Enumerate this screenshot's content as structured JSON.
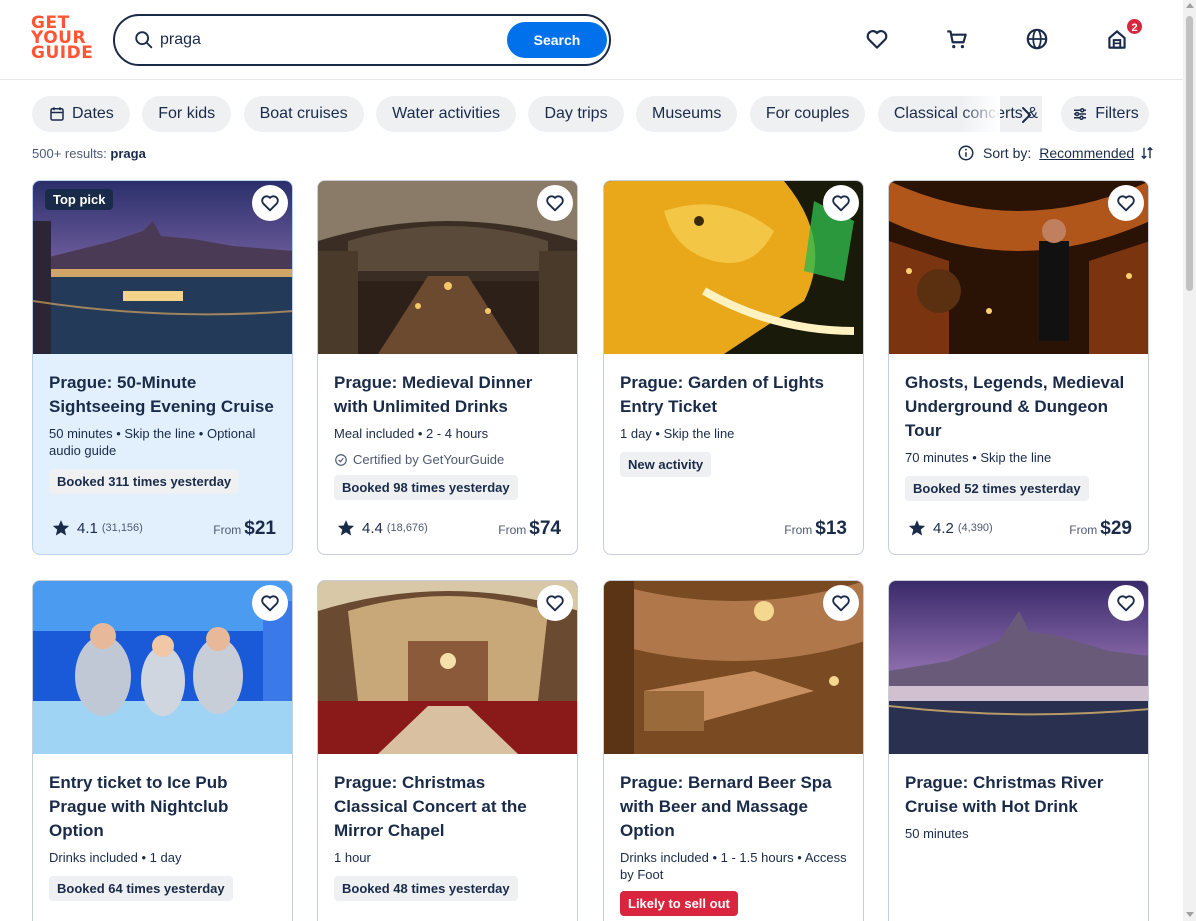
{
  "logo": {
    "line1": "GET",
    "line2": "YOUR",
    "line3": "GUIDE"
  },
  "search": {
    "value": "praga",
    "button_label": "Search"
  },
  "header": {
    "cart_badge": "2"
  },
  "chips": [
    "Dates",
    "For kids",
    "Boat cruises",
    "Water activities",
    "Day trips",
    "Museums",
    "For couples",
    "Classical concerts & opera"
  ],
  "filters_label": "Filters",
  "results": {
    "count": "500+ results:",
    "query": "praga"
  },
  "sort": {
    "label": "Sort by:",
    "value": "Recommended"
  },
  "cards": [
    {
      "title": "Prague: 50-Minute Sightseeing Evening Cruise",
      "meta": "50 minutes • Skip the line • Optional audio guide",
      "pill": "Booked 311 times yesterday",
      "rating": "4.1",
      "reviews": "(31,156)",
      "from": "From",
      "price": "$21",
      "tag": "Top pick"
    },
    {
      "title": "Prague: Medieval Dinner with Unlimited Drinks",
      "meta": "Meal included • 2 - 4 hours",
      "certified": "Certified by GetYourGuide",
      "pill": "Booked 98 times yesterday",
      "rating": "4.4",
      "reviews": "(18,676)",
      "from": "From",
      "price": "$74"
    },
    {
      "title": "Prague: Garden of Lights Entry Ticket",
      "meta": "1 day • Skip the line",
      "pill": "New activity",
      "from": "From",
      "price": "$13"
    },
    {
      "title": "Ghosts, Legends, Medieval Underground & Dungeon Tour",
      "meta": "70 minutes • Skip the line",
      "pill": "Booked 52 times yesterday",
      "rating": "4.2",
      "reviews": "(4,390)",
      "from": "From",
      "price": "$29"
    },
    {
      "title": "Entry ticket to Ice Pub Prague with Nightclub Option",
      "meta": "Drinks included • 1 day",
      "pill": "Booked 64 times yesterday"
    },
    {
      "title": "Prague: Christmas Classical Concert at the Mirror Chapel",
      "meta": "1 hour",
      "pill": "Booked 48 times yesterday"
    },
    {
      "title": "Prague: Bernard Beer Spa with Beer and Massage Option",
      "meta": "Drinks included • 1 - 1.5 hours • Access by Foot",
      "pill": "Likely to sell out"
    },
    {
      "title": "Prague: Christmas River Cruise with Hot Drink",
      "meta": "50 minutes"
    }
  ]
}
